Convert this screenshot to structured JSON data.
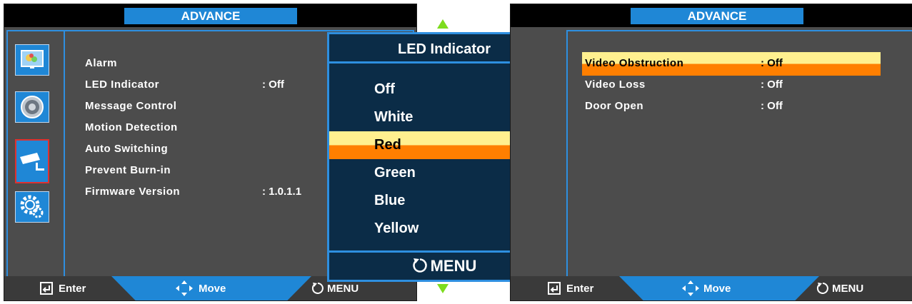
{
  "left": {
    "header_title": "ADVANCE",
    "menu": [
      {
        "label": "Alarm",
        "value": ""
      },
      {
        "label": "LED Indicator",
        "value": ": Off"
      },
      {
        "label": "Message Control",
        "value": ""
      },
      {
        "label": "Motion Detection",
        "value": ""
      },
      {
        "label": "Auto Switching",
        "value": ""
      },
      {
        "label": "Prevent Burn-in",
        "value": ""
      },
      {
        "label": "Firmware Version",
        "value": ": 1.0.1.1"
      }
    ],
    "sidebar_icons": [
      "picture-icon",
      "audio-icon",
      "camera-icon",
      "settings-gears-icon"
    ]
  },
  "popup": {
    "title": "LED Indicator",
    "options": [
      "Off",
      "White",
      "Red",
      "Green",
      "Blue",
      "Yellow"
    ],
    "selected": "Red",
    "menu_label": "MENU"
  },
  "right": {
    "header_title": "ADVANCE",
    "menu": [
      {
        "label": "Video Obstruction",
        "value": ": Off"
      },
      {
        "label": "Video Loss",
        "value": ": Off"
      },
      {
        "label": "Door Open",
        "value": ": Off"
      }
    ],
    "selected": "Video Obstruction"
  },
  "footer": {
    "enter_label": "Enter",
    "move_label": "Move",
    "menu_label": "MENU"
  },
  "colors": {
    "accent_blue": "#1f87d6",
    "panel_gray": "#4c4c4c",
    "highlight_yellow": "#fff08f",
    "highlight_orange": "#ff7f00",
    "arrow_green": "#7ddc1e"
  }
}
